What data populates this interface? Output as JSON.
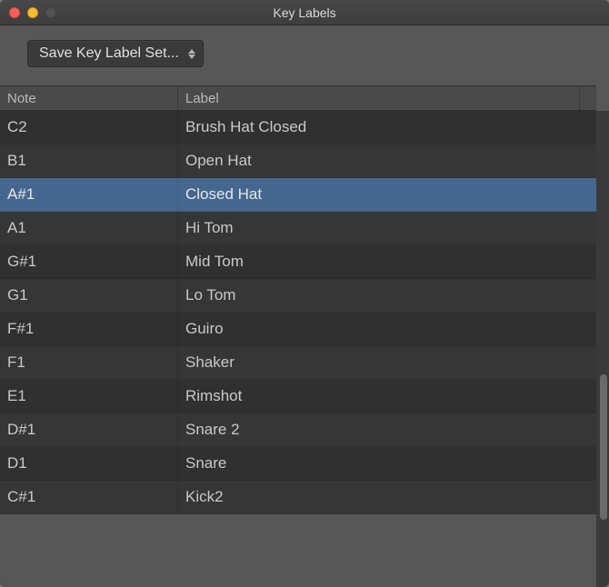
{
  "window": {
    "title": "Key Labels"
  },
  "toolbar": {
    "dropdown_label": "Save Key Label Set..."
  },
  "table": {
    "headers": {
      "note": "Note",
      "label": "Label"
    },
    "rows": [
      {
        "note": "C2",
        "label": "Brush Hat Closed",
        "selected": false
      },
      {
        "note": "B1",
        "label": "Open Hat",
        "selected": false
      },
      {
        "note": "A#1",
        "label": "Closed Hat",
        "selected": true
      },
      {
        "note": "A1",
        "label": "Hi Tom",
        "selected": false
      },
      {
        "note": "G#1",
        "label": "Mid Tom",
        "selected": false
      },
      {
        "note": "G1",
        "label": "Lo Tom",
        "selected": false
      },
      {
        "note": "F#1",
        "label": "Guiro",
        "selected": false
      },
      {
        "note": "F1",
        "label": "Shaker",
        "selected": false
      },
      {
        "note": "E1",
        "label": "Rimshot",
        "selected": false
      },
      {
        "note": "D#1",
        "label": "Snare 2",
        "selected": false
      },
      {
        "note": "D1",
        "label": "Snare",
        "selected": false
      },
      {
        "note": "C#1",
        "label": "Kick2",
        "selected": false
      }
    ]
  }
}
